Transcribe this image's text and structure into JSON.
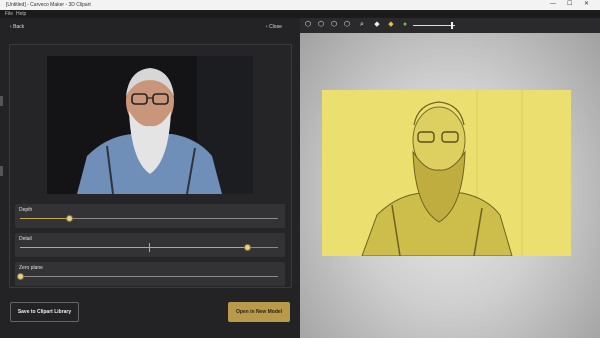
{
  "window": {
    "title": "[Untitled] - Carveco Maker - 3D Clipart",
    "controls": [
      "—",
      "☐",
      "✕"
    ]
  },
  "menu": {
    "items": [
      "File",
      "Help"
    ]
  },
  "panel": {
    "back_label": "Back",
    "close_label": "Close",
    "sliders": [
      {
        "label": "Depth",
        "value_fraction": 0.19
      },
      {
        "label": "Detail",
        "value_fraction": 0.88
      },
      {
        "label": "Zero plane",
        "value_fraction": 0.0
      }
    ],
    "save_label": "Save to Clipart Library",
    "open_label": "Open in New Model"
  },
  "toolbar": {
    "icons": [
      "cube-iso-icon",
      "cube-front-icon",
      "cube-side-icon",
      "cube-top-icon",
      "zoom-icon",
      "layer-icon",
      "layer-gold-icon",
      "material-icon"
    ],
    "zoom_level": 0.93
  },
  "colors": {
    "accent": "#c9a94f",
    "relief": "#e9dd6d",
    "button_primary": "#b89a4a"
  }
}
